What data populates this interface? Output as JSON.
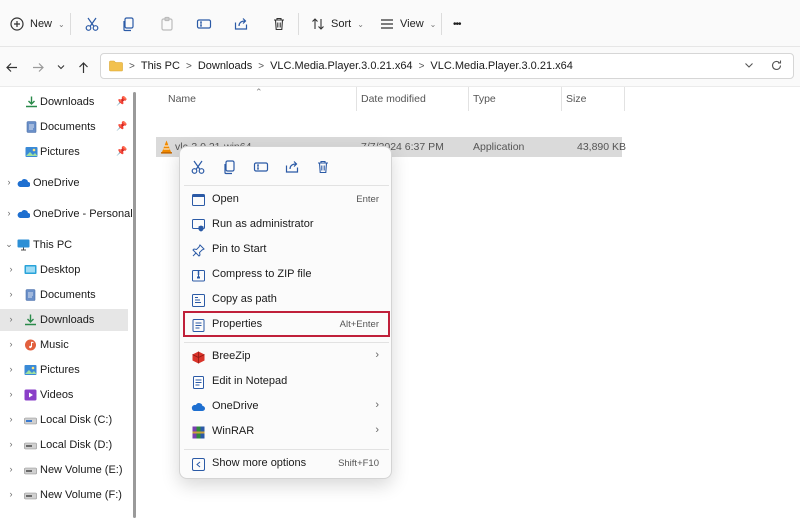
{
  "toolbar": {
    "new_label": "New",
    "sort_label": "Sort",
    "view_label": "View",
    "more_label": "•••"
  },
  "address": {
    "crumbs": [
      "This PC",
      "Downloads",
      "VLC.Media.Player.3.0.21.x64",
      "VLC.Media.Player.3.0.21.x64"
    ],
    "separator": ">"
  },
  "sidebar": {
    "items": [
      {
        "label": "Downloads",
        "icon": "download-icon",
        "pinned": true
      },
      {
        "label": "Documents",
        "icon": "document-icon",
        "pinned": true
      },
      {
        "label": "Pictures",
        "icon": "pictures-icon",
        "pinned": true
      },
      {
        "label": "OneDrive",
        "icon": "cloud-icon"
      },
      {
        "label": "OneDrive - Personal",
        "icon": "cloud-icon"
      },
      {
        "label": "This PC",
        "icon": "monitor-icon"
      },
      {
        "label": "Desktop",
        "icon": "desktop-icon"
      },
      {
        "label": "Documents",
        "icon": "document-icon"
      },
      {
        "label": "Downloads",
        "icon": "download-icon",
        "selected": true
      },
      {
        "label": "Music",
        "icon": "music-icon"
      },
      {
        "label": "Pictures",
        "icon": "pictures-icon"
      },
      {
        "label": "Videos",
        "icon": "videos-icon"
      },
      {
        "label": "Local Disk (C:)",
        "icon": "drive-icon"
      },
      {
        "label": "Local Disk (D:)",
        "icon": "drive-icon"
      },
      {
        "label": "New Volume (E:)",
        "icon": "drive-icon"
      },
      {
        "label": "New Volume (F:)",
        "icon": "drive-icon"
      }
    ]
  },
  "columns": {
    "name": "Name",
    "date_modified": "Date modified",
    "type": "Type",
    "size": "Size"
  },
  "file": {
    "name": "vlc-3.0.21-win64",
    "date_modified": "7/7/2024 6:37 PM",
    "type": "Application",
    "size": "43,890 KB"
  },
  "context_menu": {
    "top_actions": [
      "cut-icon",
      "copy-icon",
      "rename-icon",
      "share-icon",
      "delete-icon"
    ],
    "items": [
      {
        "label": "Open",
        "shortcut": "Enter",
        "icon": "open-icon"
      },
      {
        "label": "Run as administrator",
        "shortcut": "",
        "icon": "shield-icon"
      },
      {
        "label": "Pin to Start",
        "shortcut": "",
        "icon": "pin-icon"
      },
      {
        "label": "Compress to ZIP file",
        "shortcut": "",
        "icon": "zip-icon"
      },
      {
        "label": "Copy as path",
        "shortcut": "",
        "icon": "path-icon"
      },
      {
        "label": "Properties",
        "shortcut": "Alt+Enter",
        "icon": "properties-icon",
        "highlighted": true
      },
      {
        "label": "BreeZip",
        "shortcut": "",
        "icon": "breezip-icon",
        "submenu": true
      },
      {
        "label": "Edit in Notepad",
        "shortcut": "",
        "icon": "notepad-icon"
      },
      {
        "label": "OneDrive",
        "shortcut": "",
        "icon": "cloud-icon",
        "submenu": true
      },
      {
        "label": "WinRAR",
        "shortcut": "",
        "icon": "winrar-icon",
        "submenu": true
      },
      {
        "label": "Show more options",
        "shortcut": "Shift+F10",
        "icon": "more-options-icon"
      }
    ],
    "highlight_color": "#c0203a"
  }
}
